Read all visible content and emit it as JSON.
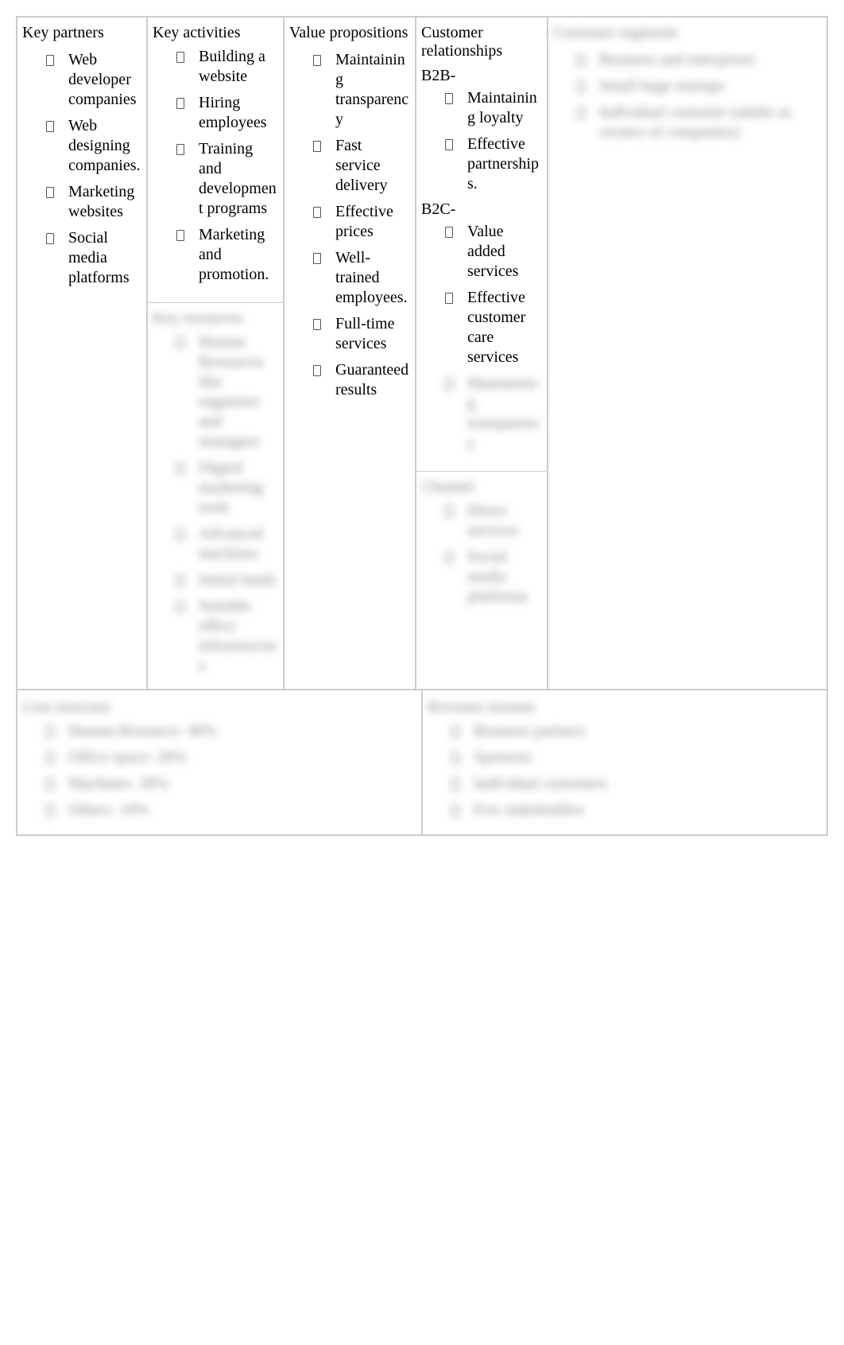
{
  "key_partners": {
    "title": "Key partners",
    "items": [
      "Web developer companies",
      "Web designing companies.",
      "Marketing websites",
      "Social media platforms"
    ]
  },
  "key_activities": {
    "title": "Key activities",
    "items": [
      "Building a website",
      "Hiring employees",
      "Training and development programs",
      "Marketing and promotion."
    ]
  },
  "key_resources": {
    "title": "Key resources",
    "items": [
      "Human Resources like engineers and managers",
      "Digital marketing tools",
      "Advanced machines",
      "Initial funds",
      "Suitable office infrastructure"
    ]
  },
  "value_propositions": {
    "title": "Value propositions",
    "items": [
      "Maintaining transparency",
      "Fast service delivery",
      "Effective prices",
      "Well-trained employees.",
      "Full-time services",
      "Guaranteed results"
    ]
  },
  "customer_relationships": {
    "title": "Customer relationships",
    "b2b_label": "B2B-",
    "b2b_items": [
      "Maintaining loyalty",
      "Effective partnerships."
    ],
    "b2c_label": "B2C-",
    "b2c_items": [
      "Value added services",
      "Effective customer care services",
      "Maintaining transparency"
    ]
  },
  "channels": {
    "title": "Channel",
    "items": [
      "Direct services",
      "Social media platforms"
    ]
  },
  "customer_segments": {
    "title": "Customer segments",
    "items": [
      "Business and enterprises",
      "Small huge startups",
      "Individual customer (adults as owners of companies)"
    ]
  },
  "cost_structure": {
    "title": "Cost structure",
    "items": [
      "Human Resource- 40%",
      "Office space- 20%",
      "Machines- 30%",
      "Others- 10%"
    ]
  },
  "revenue_streams": {
    "title": "Revenue streams",
    "items": [
      "Business partners",
      "Sponsors",
      "Individual customers",
      "Few stakeholders"
    ]
  }
}
